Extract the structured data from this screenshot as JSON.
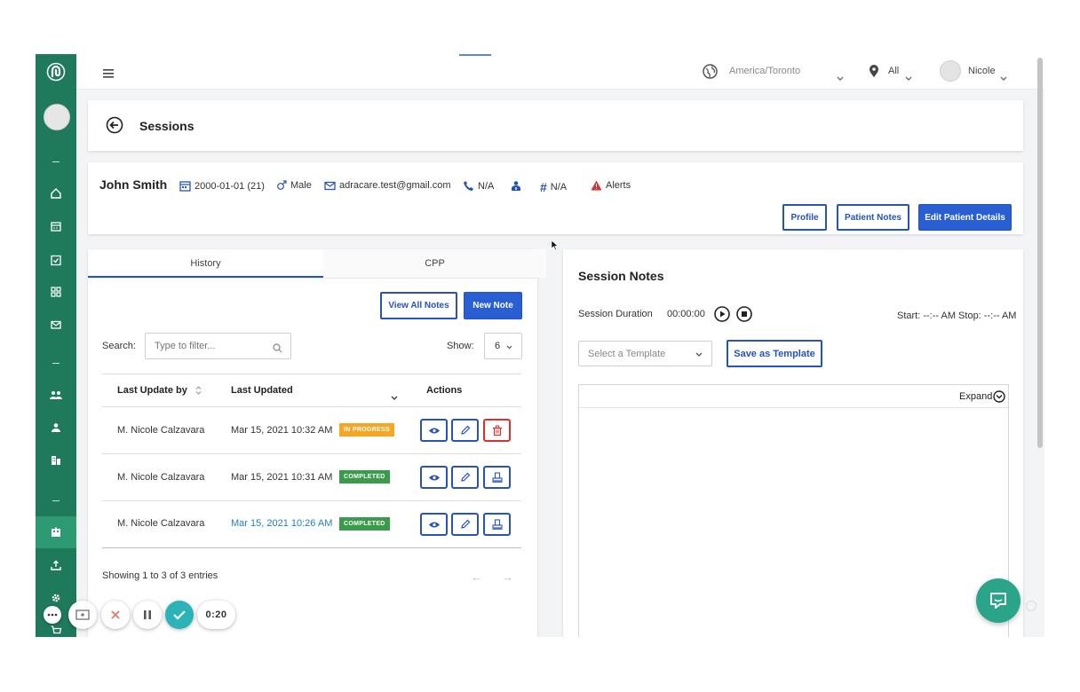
{
  "topbar": {
    "timezone": "America/Toronto",
    "location": "All",
    "user": "Nicole"
  },
  "page": {
    "title": "Sessions"
  },
  "patient": {
    "name": "John Smith",
    "dob": "2000-01-01 (21)",
    "gender": "Male",
    "email": "adracare.test@gmail.com",
    "phone": "N/A",
    "number": "N/A",
    "alerts": "Alerts",
    "buttons": {
      "profile": "Profile",
      "patient_notes": "Patient Notes",
      "edit_details": "Edit Patient Details"
    }
  },
  "history": {
    "tabs": [
      "History",
      "CPP"
    ],
    "view_all_label": "View All Notes",
    "new_note_label": "New Note",
    "search_label": "Search:",
    "search_placeholder": "Type to filter...",
    "show_label": "Show:",
    "show_value": "6",
    "columns": [
      "Last Update by",
      "Last Updated",
      "Actions"
    ],
    "rows": [
      {
        "by": "M. Nicole Calzavara",
        "updated": "Mar 15, 2021 10:32 AM",
        "status": "IN PROGRESS"
      },
      {
        "by": "M. Nicole Calzavara",
        "updated": "Mar 15, 2021 10:31 AM",
        "status": "COMPLETED"
      },
      {
        "by": "M. Nicole Calzavara",
        "updated": "Mar 15, 2021 10:26 AM",
        "status": "COMPLETED"
      }
    ],
    "footer": "Showing 1 to 3 of 3 entries"
  },
  "session": {
    "title": "Session Notes",
    "duration_label": "Session Duration",
    "duration_value": "00:00:00",
    "start_stop": "Start: --:-- AM Stop: --:-- AM",
    "template_placeholder": "Select a Template",
    "save_template_label": "Save as Template",
    "expand_label": "Expand"
  },
  "recorder": {
    "timer": "0:20"
  },
  "colors": {
    "sidebar": "#1f7a5c",
    "primary": "#2a5fd3",
    "in_progress": "#f5a623",
    "completed": "#3a9b4c",
    "danger": "#d93030",
    "link": "#1e7fc2",
    "chat_fab": "#2aa58a",
    "recorder_check": "#2bb3b8"
  }
}
